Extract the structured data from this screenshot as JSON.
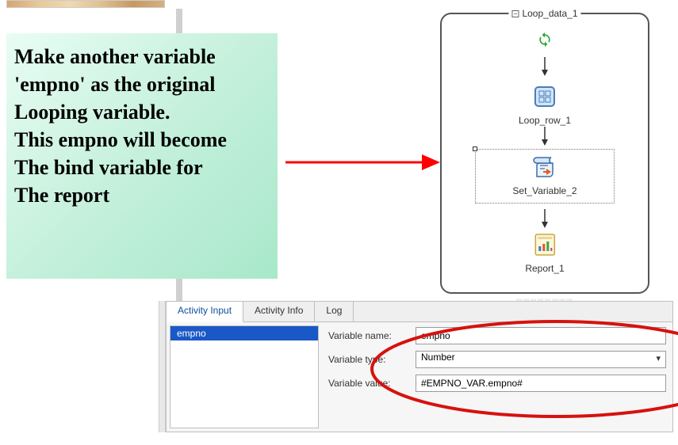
{
  "note_text": "Make another variable 'empno' as the original Looping variable.\nThis empno will become The bind variable for The report",
  "flow": {
    "loop_data_label": "Loop_data_1",
    "loop_row_label": "Loop_row_1",
    "set_variable_label": "Set_Variable_2",
    "report_label": "Report_1"
  },
  "panel": {
    "tabs": [
      "Activity Input",
      "Activity Info",
      "Log"
    ],
    "active_tab": 0,
    "list_selected": "empno",
    "fields": {
      "var_name_label": "Variable name:",
      "var_name_value": "empno",
      "var_type_label": "Variable type:",
      "var_type_value": "Number",
      "var_value_label": "Variable value:",
      "var_value_value": "#EMPNO_VAR.empno#"
    }
  }
}
